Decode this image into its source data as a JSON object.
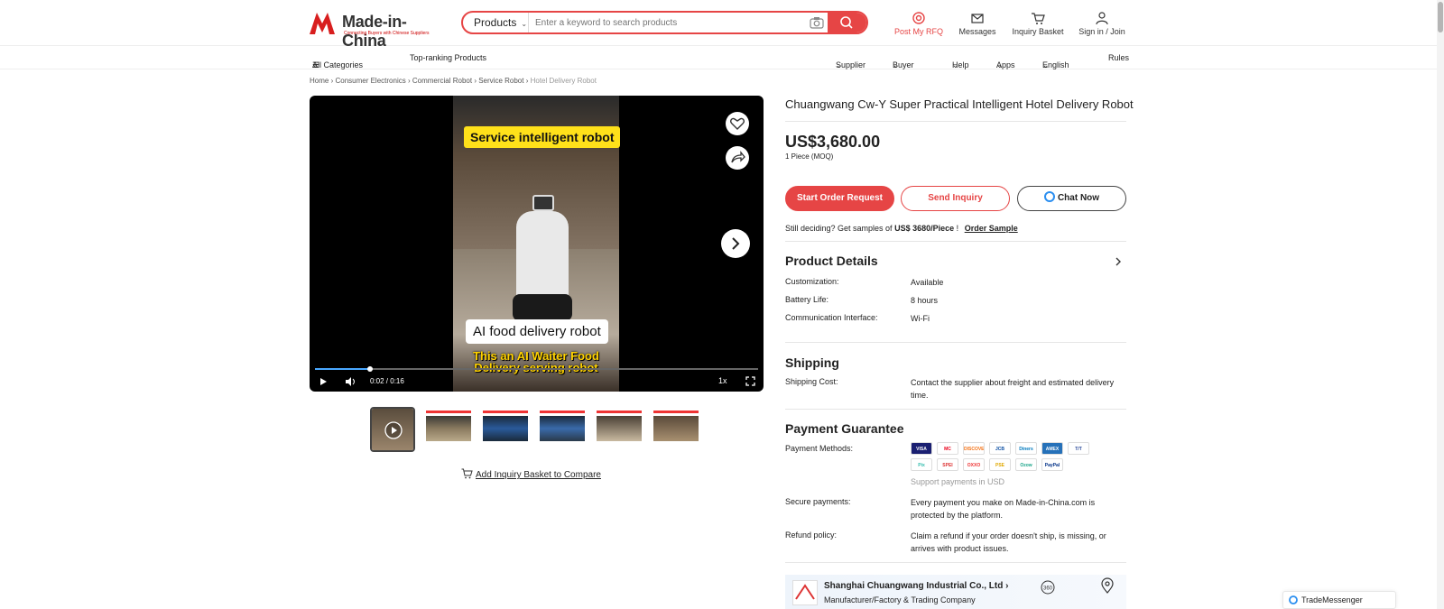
{
  "header": {
    "logo_text": "Made-in-China",
    "logo_tagline": "Connecting Buyers with Chinese Suppliers",
    "search": {
      "category": "Products",
      "placeholder": "Enter a keyword to search products"
    },
    "links": {
      "rfq": "Post My RFQ",
      "messages": "Messages",
      "basket": "Inquiry Basket",
      "signin": "Sign in / Join"
    },
    "accent_color": "#e64545"
  },
  "nav": {
    "all_categories": "All Categories",
    "top_ranking": "Top-ranking Products",
    "supplier": "Supplier",
    "buyer": "Buyer",
    "help": "Help",
    "apps": "Apps",
    "language": "English",
    "rules": "Rules"
  },
  "breadcrumb": [
    "Home",
    "Consumer Electronics",
    "Commercial Robot",
    "Service Robot",
    "Hotel Delivery Robot"
  ],
  "video": {
    "caption_top": "Service intelligent robot",
    "caption_middle": "AI food delivery robot",
    "caption_bottom": "This an AI Waiter Food Delivery serving robot",
    "time": "0:02 / 0:16",
    "speed": "1x",
    "progress": 0.125
  },
  "compare_label": "Add Inquiry Basket to Compare",
  "product": {
    "title": "Chuangwang Cw-Y Super Practical Intelligent Hotel Delivery Robot",
    "price": "US$3,680.00",
    "moq": "1 Piece (MOQ)",
    "buttons": {
      "order": "Start Order Request",
      "inquiry": "Send Inquiry",
      "chat": "Chat Now"
    },
    "sample_text": "Still deciding? Get samples of",
    "sample_price": "US$ 3680/Piece",
    "sample_excl": "!",
    "sample_link": "Order Sample"
  },
  "details": {
    "title": "Product Details",
    "rows": [
      {
        "label": "Customization:",
        "value": "Available"
      },
      {
        "label": "Battery Life:",
        "value": "8 hours"
      },
      {
        "label": "Communication Interface:",
        "value": "Wi-Fi"
      }
    ]
  },
  "shipping": {
    "title": "Shipping",
    "label": "Shipping Cost:",
    "value": "Contact the supplier about freight and estimated delivery time."
  },
  "payment": {
    "title": "Payment Guarantee",
    "methods_label": "Payment Methods:",
    "cards": [
      "VISA",
      "MC",
      "DISCOVER",
      "JCB",
      "Diners",
      "AMEX",
      "T/T",
      "Pix",
      "SPEI",
      "OXXO",
      "PSE",
      "Ozow",
      "PayPal"
    ],
    "support": "Support payments in USD",
    "secure_label": "Secure payments:",
    "secure_value": "Every payment you make on Made-in-China.com is protected by the platform.",
    "refund_label": "Refund policy:",
    "refund_value": "Claim a refund if your order doesn't ship, is missing, or arrives with product issues."
  },
  "company": {
    "name": "Shanghai Chuangwang Industrial Co., Ltd",
    "type": "Manufacturer/Factory & Trading Company"
  },
  "trade_messenger": "TradeMessenger"
}
